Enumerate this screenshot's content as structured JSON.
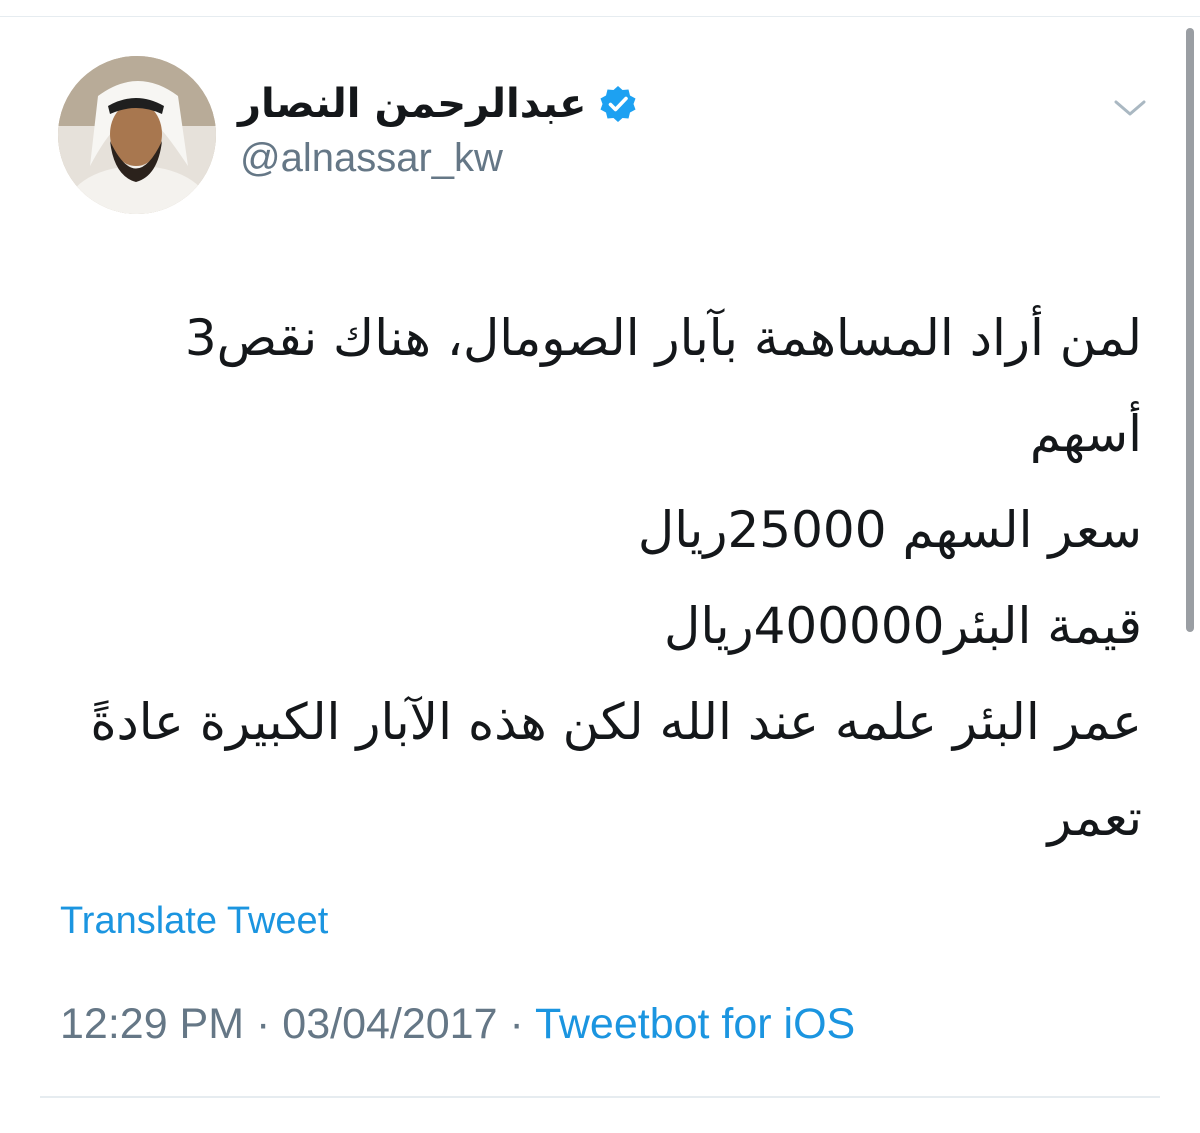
{
  "author": {
    "display_name": "عبدالرحمن النصار",
    "handle": "@alnassar_kw",
    "verified": true,
    "avatar_icon": "profile-photo"
  },
  "tweet": {
    "lines": [
      "لمن أراد المساهمة بآبار الصومال، هناك نقص3",
      "أسهم",
      "سعر السهم 25000ريال",
      "قيمة البئر400000ريال",
      "عمر البئر علمه عند الله لكن هذه الآبار الكبيرة عادةً",
      "تعمر"
    ]
  },
  "actions": {
    "translate_label": "Translate Tweet"
  },
  "meta": {
    "time": "12:29 PM",
    "separator": "·",
    "date": "03/04/2017",
    "source": "Tweetbot for iOS"
  },
  "colors": {
    "link": "#1b95e0",
    "secondary_text": "#657786",
    "verified_badge": "#1da1f2"
  },
  "icons": {
    "verified": "verified-badge-icon",
    "menu": "chevron-down-icon"
  }
}
